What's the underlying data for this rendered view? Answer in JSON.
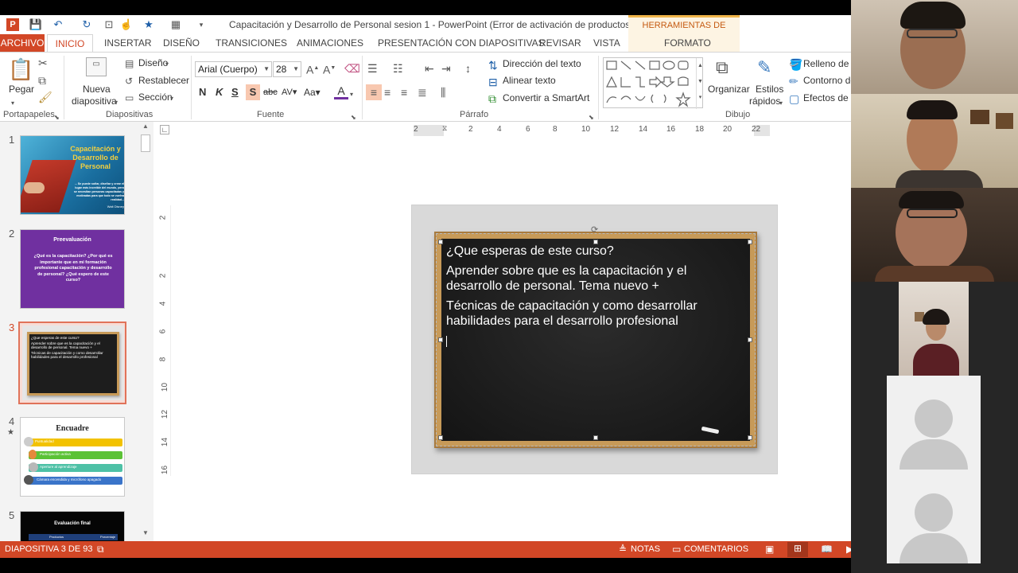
{
  "window": {
    "title": "Capacitación y Desarrollo de Personal sesion 1 - PowerPoint (Error de activación de productos)",
    "context_tab_group": "HERRAMIENTAS DE DIBUJO"
  },
  "tabs": [
    "ARCHIVO",
    "INICIO",
    "INSERTAR",
    "DISEÑO",
    "TRANSICIONES",
    "ANIMACIONES",
    "PRESENTACIÓN CON DIAPOSITIVAS",
    "REVISAR",
    "VISTA",
    "FORMATO"
  ],
  "ribbon": {
    "groups": {
      "portapapeles": "Portapapeles",
      "diapositivas": "Diapositivas",
      "fuente": "Fuente",
      "parrafo": "Párrafo",
      "dibujo": "Dibujo"
    },
    "pegar": "Pegar",
    "nueva_diapositiva_1": "Nueva",
    "nueva_diapositiva_2": "diapositiva",
    "diseno": "Diseño",
    "restablecer": "Restablecer",
    "seccion": "Sección",
    "font_name": "Arial (Cuerpo)",
    "font_size": "28",
    "direccion_texto": "Dirección del texto",
    "alinear_texto": "Alinear texto",
    "convertir_smartart": "Convertir a SmartArt",
    "organizar": "Organizar",
    "estilos_1": "Estilos",
    "estilos_2": "rápidos",
    "relleno": "Relleno de fo",
    "contorno": "Contorno de",
    "efectos": "Efectos de fo",
    "accent": "#d24726"
  },
  "thumbnails": {
    "numbers": [
      "1",
      "2",
      "3",
      "4",
      "5"
    ],
    "s1_title": "Capacitación y Desarrollo de Personal",
    "s1_quote": "... Se puede soñar, diseñar y crear el lugar más increíble del mundo, pero se necesitan personas capacitadas y motivadas para que todo se vuelva realidad...",
    "s1_author": "Walt Disney",
    "s2_title": "Preevaluación",
    "s2_body": "¿Qué es la capacitación? ¿Por qué es importante que en mi formación profesional capacitación y desarrollo de personal? ¿Qué espero de este curso?",
    "s3_line1": "¿Que esperas de este curso?",
    "s3_line2": "Aprender sobre que es la capacitación y el desarrollo de personal. Tema nuevo +",
    "s3_line3": "Técnicas de capacitación y como desarrollar habilidades para el desarrollo profesional",
    "s4_title": "Encuadre",
    "s4_items": [
      "Puntualidad",
      "Participación activa",
      "Aperture al aprendizaje",
      "Cámara encendida y micrófono apagado"
    ],
    "s4_mark": "★",
    "s5_title": "Evaluación final",
    "s5_col1": "Productos",
    "s5_col2": "Porcentaje"
  },
  "ruler": {
    "h_ticks": [
      "2",
      "2",
      "4",
      "6",
      "8",
      "10",
      "12",
      "14",
      "16",
      "18",
      "20",
      "22"
    ],
    "v_ticks": [
      "2",
      "2",
      "4",
      "6",
      "8",
      "10",
      "12",
      "14",
      "16"
    ]
  },
  "slide": {
    "line1": "¿Que esperas de este curso?",
    "line2a": "Aprender sobre que es la capacitación y el",
    "line2b": "desarrollo de personal. Tema nuevo +",
    "line3a": "Técnicas de capacitación y como desarrollar",
    "line3b": "habilidades para el desarrollo profesional"
  },
  "status": {
    "slide_counter": "DIAPOSITIVA 3 DE 93",
    "notas": "NOTAS",
    "comentarios": "COMENTARIOS"
  }
}
